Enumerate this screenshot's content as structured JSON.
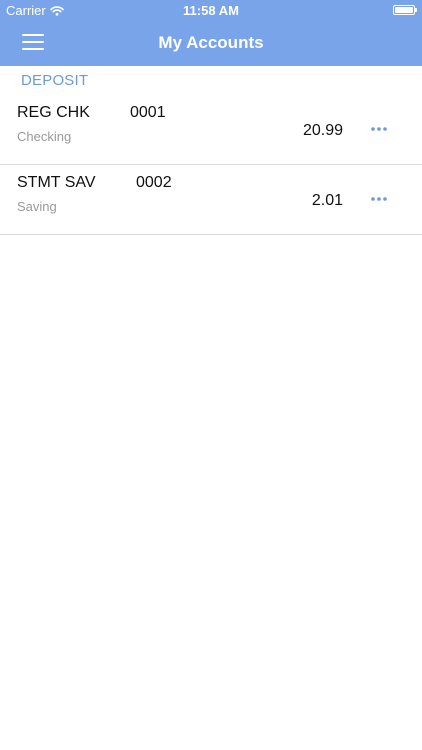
{
  "status_bar": {
    "carrier": "Carrier",
    "time": "11:58 AM"
  },
  "nav": {
    "title": "My Accounts",
    "menu_icon": "hamburger-menu-icon"
  },
  "section": {
    "title": "DEPOSIT"
  },
  "accounts": [
    {
      "name": "REG CHK",
      "number": "0001",
      "type": "Checking",
      "balance": "20.99",
      "more_icon": "more-ellipsis-icon"
    },
    {
      "name": "STMT SAV",
      "number": "0002",
      "type": "Saving",
      "balance": "2.01",
      "more_icon": "more-ellipsis-icon"
    }
  ],
  "colors": {
    "header": "#7aa4ea",
    "accent": "#6c9ad8",
    "secondary_text": "#9a9a9a",
    "divider": "#dcdcdc"
  }
}
